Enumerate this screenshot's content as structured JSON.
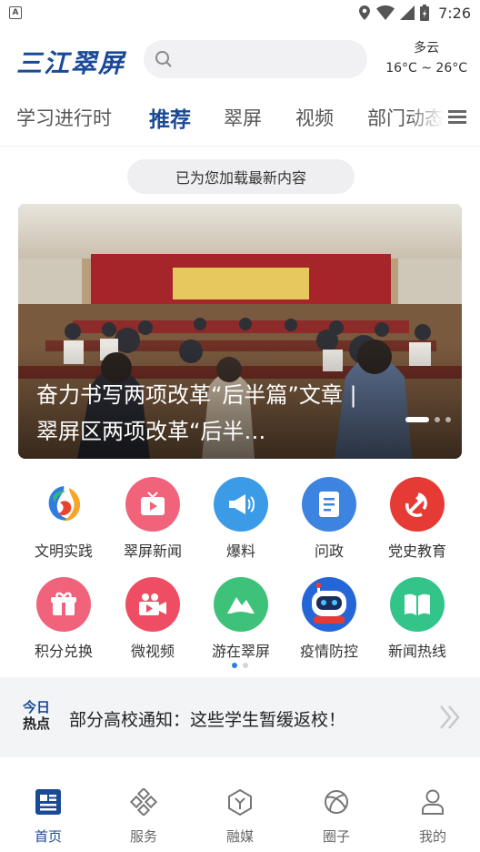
{
  "status_bar": {
    "time": "7:26",
    "app_badge": "A"
  },
  "header": {
    "logo_text": "三江翠屏",
    "search_placeholder": "",
    "weather": {
      "condition": "多云",
      "temp_range": "16°C ~ 26°C"
    }
  },
  "tabs": [
    {
      "label": "学习进行时",
      "active": false
    },
    {
      "label": "推荐",
      "active": true
    },
    {
      "label": "翠屏",
      "active": false
    },
    {
      "label": "视频",
      "active": false
    },
    {
      "label": "部门动态",
      "active": false
    }
  ],
  "toast": {
    "text": "已为您加载最新内容"
  },
  "banner": {
    "caption": "奋力书写两项改革“后半篇”文章 | 翠屏区两项改革“后半…",
    "slide_count": 3,
    "active_slide": 1
  },
  "grid_items": [
    {
      "label": "文明实践",
      "icon": "swirl-logo-icon",
      "color": "#ffffff"
    },
    {
      "label": "翠屏新闻",
      "icon": "tv-icon",
      "color": "#f0637a"
    },
    {
      "label": "爆料",
      "icon": "megaphone-icon",
      "color": "#3b9be6"
    },
    {
      "label": "问政",
      "icon": "document-icon",
      "color": "#3d83e0"
    },
    {
      "label": "党史教育",
      "icon": "party-emblem-icon",
      "color": "#e63a35"
    },
    {
      "label": "积分兑换",
      "icon": "gift-icon",
      "color": "#f0637a"
    },
    {
      "label": "微视频",
      "icon": "video-camera-icon",
      "color": "#ee4d63"
    },
    {
      "label": "游在翠屏",
      "icon": "mountain-icon",
      "color": "#3ec27a"
    },
    {
      "label": "疫情防控",
      "icon": "robot-icon",
      "color": "#2466d8"
    },
    {
      "label": "新闻热线",
      "icon": "book-icon",
      "color": "#33c48a"
    }
  ],
  "grid_pages": {
    "count": 2,
    "active": 1
  },
  "hot": {
    "tag_line1": "今日",
    "tag_line2": "热点",
    "text": "部分高校通知：这些学生暂缓返校！"
  },
  "bottom_nav": [
    {
      "label": "首页",
      "icon": "home-news-icon",
      "active": true
    },
    {
      "label": "服务",
      "icon": "service-grid-icon",
      "active": false
    },
    {
      "label": "融媒",
      "icon": "hexagon-media-icon",
      "active": false
    },
    {
      "label": "圈子",
      "icon": "circle-community-icon",
      "active": false
    },
    {
      "label": "我的",
      "icon": "user-icon",
      "active": false
    }
  ],
  "colors": {
    "brand": "#1a4a97",
    "accent": "#2f7de1"
  }
}
